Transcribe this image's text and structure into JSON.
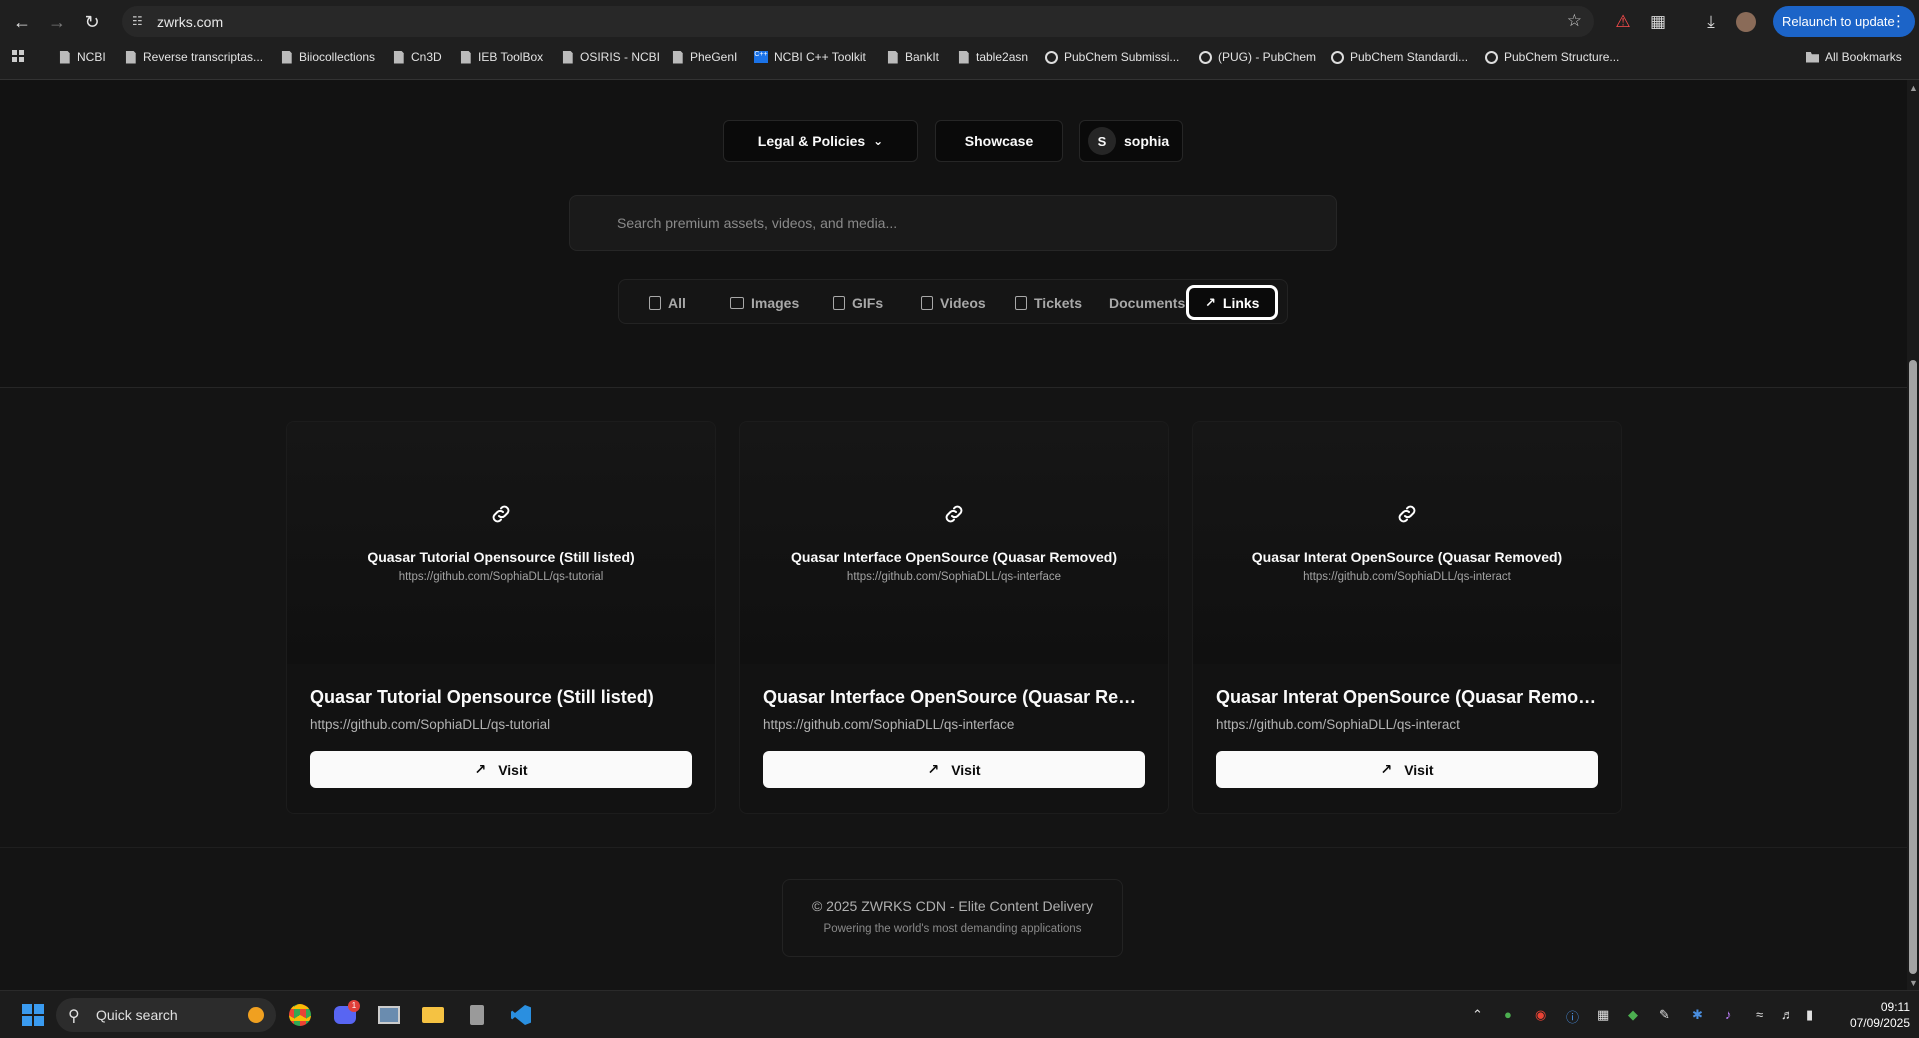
{
  "browser": {
    "url": "zwrks.com",
    "relaunch_label": "Relaunch to update",
    "bookmarks": [
      "NCBI",
      "Reverse transcriptas...",
      "Biiocollections",
      "Cn3D",
      "IEB ToolBox",
      "OSIRIS - NCBI",
      "PheGenI",
      "NCBI C++ Toolkit",
      "BankIt",
      "table2asn",
      "PubChem Submissi...",
      "(PUG) - PubChem",
      "PubChem Standardi...",
      "PubChem Structure..."
    ],
    "all_bookmarks": "All Bookmarks"
  },
  "nav": {
    "legal": "Legal & Policies",
    "showcase": "Showcase",
    "user_initial": "S",
    "user_name": "sophia"
  },
  "search": {
    "placeholder": "Search premium assets, videos, and media..."
  },
  "tabs": {
    "all": "All",
    "images": "Images",
    "gifs": "GIFs",
    "videos": "Videos",
    "tickets": "Tickets",
    "documents": "Documents",
    "links": "Links",
    "active": "Links"
  },
  "cards": [
    {
      "title": "Quasar Tutorial Opensource (Still listed)",
      "title_display": "Quasar Tutorial Opensource (Still listed)",
      "url": "https://github.com/SophiaDLL/qs-tutorial",
      "visit": "Visit"
    },
    {
      "title": "Quasar Interface OpenSource (Quasar Removed)",
      "title_display": "Quasar Interface OpenSource (Quasar Remo...",
      "url": "https://github.com/SophiaDLL/qs-interface",
      "visit": "Visit"
    },
    {
      "title": "Quasar Interat OpenSource (Quasar Removed)",
      "title_display": "Quasar Interat OpenSource (Quasar Removed)",
      "url": "https://github.com/SophiaDLL/qs-interact",
      "visit": "Visit"
    }
  ],
  "footer": {
    "copyright": "© 2025 ZWRKS CDN - Elite Content Delivery",
    "tagline": "Powering the world's most demanding applications"
  },
  "taskbar": {
    "search_label": "Quick search",
    "time": "09:11",
    "date": "07/09/2025",
    "discord_badge": "1"
  },
  "colors": {
    "page_bg": "#141414",
    "accent_relaunch": "#1c64c8",
    "card_bg": "#121212",
    "button_bg": "#fafafa"
  }
}
